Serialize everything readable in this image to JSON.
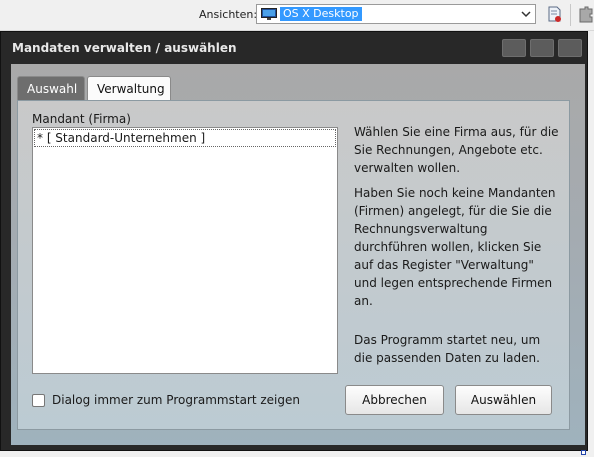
{
  "toolbar": {
    "view_label": "Ansichten:",
    "view_value": "OS X Desktop",
    "view_icon": "monitor-icon",
    "doc_icon": "document-settings-icon",
    "puzzle_icon": "puzzle-icon"
  },
  "dialog": {
    "title": "Mandaten verwalten / auswählen",
    "tabs": [
      {
        "label": "Auswahl",
        "active": true
      },
      {
        "label": "Verwaltung",
        "active": false
      }
    ],
    "list_label": "Mandant (Firma)",
    "list_items": [
      "* [ Standard-Unternehmen ]"
    ],
    "info_1": "Wählen Sie eine Firma aus, für die Sie Rechnungen, Angebote etc. verwalten wollen.",
    "info_2": "Haben Sie noch keine Mandanten (Firmen) angelegt, für die Sie die Rechnungsverwaltung durchführen wollen, klicken Sie auf das Register \"Verwaltung\" und legen entsprechende Firmen an.",
    "info_3": "Das Programm startet neu, um die passenden Daten zu laden.",
    "checkbox_label": "Dialog immer zum Programmstart zeigen",
    "checkbox_checked": false,
    "cancel_label": "Abbrechen",
    "select_label": "Auswählen"
  },
  "colors": {
    "title_bar": "#282828",
    "selection": "#3399ff",
    "active_tab": "#6e6e6e"
  }
}
